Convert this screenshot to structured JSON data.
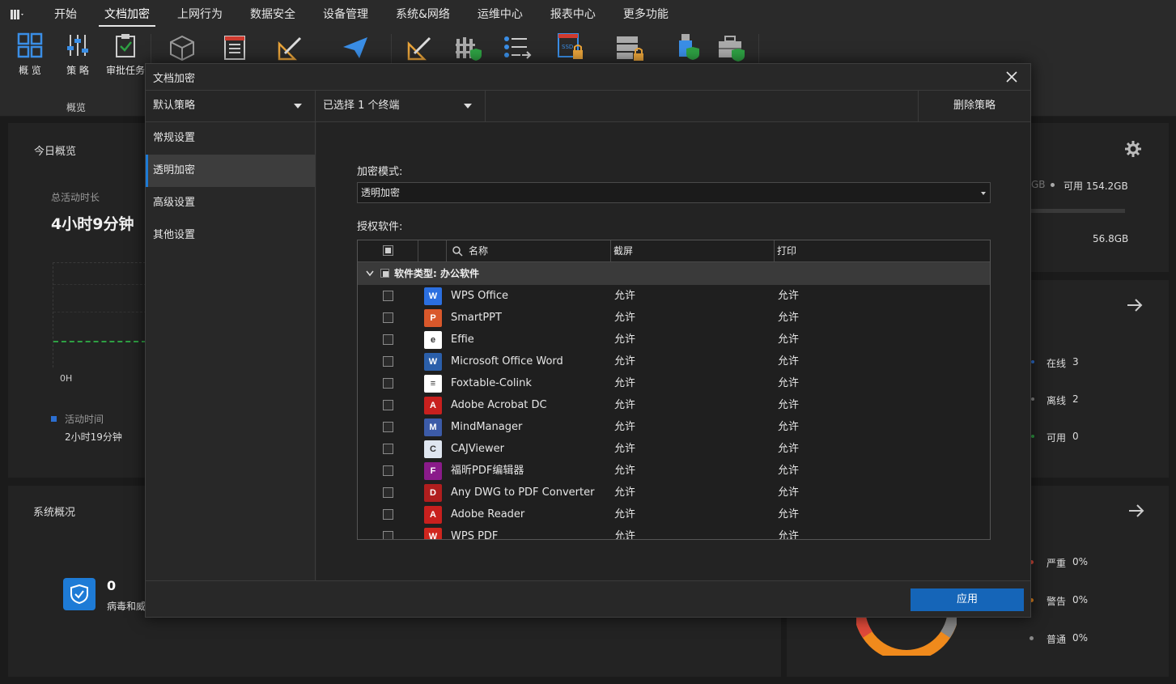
{
  "menubar": {
    "items": [
      "开始",
      "文档加密",
      "上网行为",
      "数据安全",
      "设备管理",
      "系统&网络",
      "运维中心",
      "报表中心",
      "更多功能"
    ],
    "active_index": 1
  },
  "ribbon": {
    "buttons": [
      {
        "label": "概 览",
        "icon": "overview-grid-icon"
      },
      {
        "label": "策 略",
        "icon": "policy-sliders-icon"
      },
      {
        "label": "审批任务",
        "icon": "approval-clipboard-icon"
      }
    ],
    "group_label": "概览",
    "extra_icons": [
      "cube-icon",
      "document-list-icon",
      "ruler-pencil-icon",
      "paper-plane-icon",
      "ruler-pencil-icon",
      "firewall-shield-icon",
      "list-arrows-icon",
      "ssd-lock-icon",
      "server-lock-icon",
      "usb-shield-icon",
      "briefcase-shield-icon"
    ]
  },
  "dashboard": {
    "today_title": "今日概览",
    "active_label": "总活动时长",
    "active_value": "4小时9分钟",
    "axis_label": "0H",
    "legend_label": "活动时间",
    "legend_value": "2小时19分钟",
    "system_title": "系统概况",
    "virus_count": "0",
    "virus_label": "病毒和威",
    "disk_partial": "GB",
    "disk_available": "可用 154.2GB",
    "disk_other": "56.8GB",
    "terminals": [
      {
        "label": "在线",
        "value": "3",
        "color": "#2c6fd1"
      },
      {
        "label": "离线",
        "value": "2",
        "color": "#888888"
      },
      {
        "label": "可用",
        "value": "0",
        "color": "#2ea043"
      }
    ],
    "alerts": [
      {
        "label": "严重",
        "value": "0%",
        "color": "#e04a3a"
      },
      {
        "label": "警告",
        "value": "0%",
        "color": "#f08a1c"
      },
      {
        "label": "普通",
        "value": "0%",
        "color": "#888888"
      }
    ]
  },
  "dialog": {
    "title": "文档加密",
    "policy": "默认策略",
    "terminals": "已选择 1 个终端",
    "delete_policy": "删除策略",
    "side_items": [
      "常规设置",
      "透明加密",
      "高级设置",
      "其他设置"
    ],
    "active_side_index": 1,
    "mode_label": "加密模式:",
    "mode_value": "透明加密",
    "software_label": "授权软件:",
    "columns": {
      "name": "名称",
      "screenshot": "截屏",
      "print": "打印"
    },
    "group_label": "软件类型: 办公软件",
    "rows": [
      {
        "name": "WPS Office",
        "screenshot": "允许",
        "print": "允许",
        "icon": "wps-icon",
        "icon_color": "#2b6fe0",
        "icon_text": "W"
      },
      {
        "name": "SmartPPT",
        "screenshot": "允许",
        "print": "允许",
        "icon": "smartppt-icon",
        "icon_color": "#d9582b",
        "icon_text": "P"
      },
      {
        "name": "Effie",
        "screenshot": "允许",
        "print": "允许",
        "icon": "effie-icon",
        "icon_color": "#ffffff",
        "icon_text": "e"
      },
      {
        "name": "Microsoft Office Word",
        "screenshot": "允许",
        "print": "允许",
        "icon": "word-icon",
        "icon_color": "#2b5faa",
        "icon_text": "W"
      },
      {
        "name": "Foxtable-Colink",
        "screenshot": "允许",
        "print": "允许",
        "icon": "foxtable-icon",
        "icon_color": "#ffffff",
        "icon_text": "≡"
      },
      {
        "name": "Adobe Acrobat DC",
        "screenshot": "允许",
        "print": "允许",
        "icon": "acrobat-icon",
        "icon_color": "#c8201e",
        "icon_text": "A"
      },
      {
        "name": "MindManager",
        "screenshot": "允许",
        "print": "允许",
        "icon": "mindmanager-icon",
        "icon_color": "#3c5ba8",
        "icon_text": "M"
      },
      {
        "name": "CAJViewer",
        "screenshot": "允许",
        "print": "允许",
        "icon": "cajviewer-icon",
        "icon_color": "#dfe6f0",
        "icon_text": "C"
      },
      {
        "name": "福昕PDF编辑器",
        "screenshot": "允许",
        "print": "允许",
        "icon": "foxit-icon",
        "icon_color": "#8a1b8a",
        "icon_text": "F"
      },
      {
        "name": "Any DWG to PDF Converter",
        "screenshot": "允许",
        "print": "允许",
        "icon": "dwg-icon",
        "icon_color": "#b01e1e",
        "icon_text": "D"
      },
      {
        "name": "Adobe Reader",
        "screenshot": "允许",
        "print": "允许",
        "icon": "adobe-reader-icon",
        "icon_color": "#c8201e",
        "icon_text": "A"
      },
      {
        "name": "WPS PDF",
        "screenshot": "允许",
        "print": "允许",
        "icon": "wps-pdf-icon",
        "icon_color": "#d0261e",
        "icon_text": "W"
      }
    ],
    "apply": "应用"
  }
}
